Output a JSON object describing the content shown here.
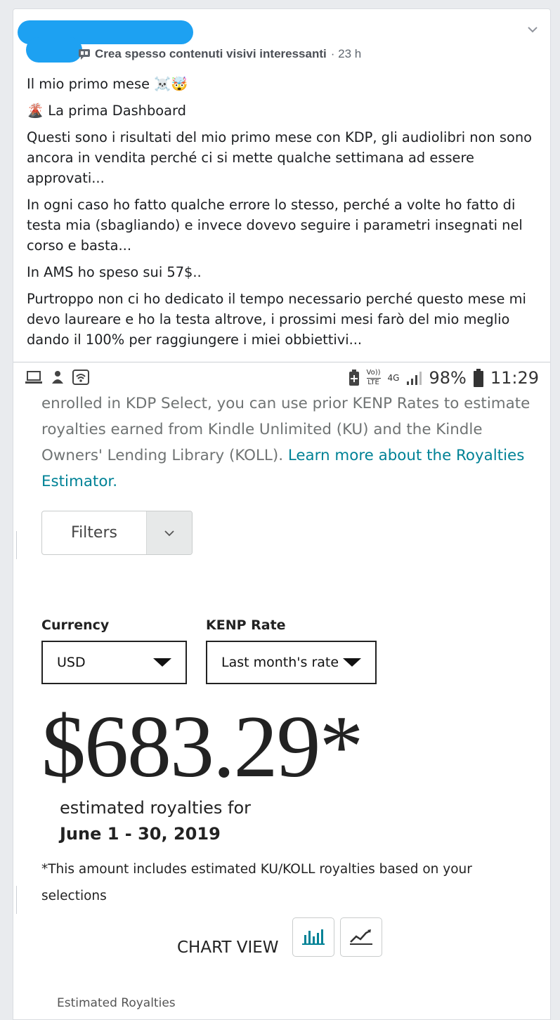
{
  "post": {
    "badge_text": "Crea spesso contenuti visivi interessanti",
    "time": "· 23 h",
    "paragraphs": [
      "Il mio primo mese ☠️🤯",
      "🌋 La prima Dashboard",
      "Questi sono i risultati del mio primo mese con KDP, gli audiolibri non sono ancora in vendita perché ci si mette qualche settimana ad essere approvati...",
      "In ogni caso ho fatto qualche errore lo stesso, perché a volte ho fatto di testa mia (sbagliando) e invece dovevo seguire i parametri insegnati nel corso e basta...",
      "In AMS ho speso sui 57$..",
      "Purtroppo non ci ho dedicato il tempo necessario perché questo mese mi devo laureare e ho la testa altrove, i prossimi mesi farò del mio meglio dando il 100% per raggiungere i miei obbiettivi..."
    ]
  },
  "statusbar": {
    "volte_top": "Vo))",
    "volte_bottom": "LTE",
    "network": "4G",
    "battery": "98%",
    "time": "11:29"
  },
  "kdp": {
    "intro_text": "enrolled in KDP Select, you can use prior KENP Rates to estimate royalties earned from Kindle Unlimited (KU) and the Kindle Owners' Lending Library (KOLL).",
    "learn_more_link": "Learn more about the Royalties Estimator.",
    "filters_label": "Filters",
    "currency_label": "Currency",
    "currency_value": "USD",
    "kenp_label": "KENP Rate",
    "kenp_value": "Last month's rate",
    "amount": "$683.29*",
    "estimated_label": "estimated royalties for",
    "date_range": "June 1 - 30, 2019",
    "footnote": "*This amount includes estimated KU/KOLL royalties based on your selections",
    "chart_view_label": "CHART VIEW",
    "estimated_royalties_heading": "Estimated Royalties"
  },
  "colors": {
    "link": "#008296",
    "redaction": "#1da1f2"
  }
}
